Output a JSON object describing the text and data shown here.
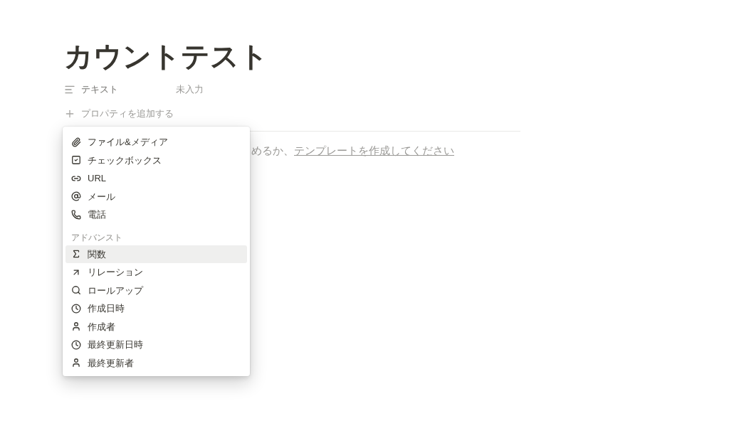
{
  "page": {
    "title": "カウントテスト",
    "properties": [
      {
        "kind": "text",
        "name": "テキスト",
        "value": "未入力"
      }
    ],
    "add_property": "プロパティを追加する",
    "hint": {
      "text": "めるか、",
      "link": "テンプレートを作成してください"
    }
  },
  "menu": {
    "sections": [
      {
        "items": [
          {
            "kind": "file",
            "label": "ファイル&メディア",
            "selected": false
          },
          {
            "kind": "checkbox",
            "label": "チェックボックス",
            "selected": false
          },
          {
            "kind": "url",
            "label": "URL",
            "selected": false
          },
          {
            "kind": "email",
            "label": "メール",
            "selected": false
          },
          {
            "kind": "phone",
            "label": "電話",
            "selected": false
          }
        ]
      },
      {
        "header": "アドバンスト",
        "items": [
          {
            "kind": "formula",
            "label": "関数",
            "selected": true
          },
          {
            "kind": "relation",
            "label": "リレーション",
            "selected": false
          },
          {
            "kind": "rollup",
            "label": "ロールアップ",
            "selected": false
          },
          {
            "kind": "created_time",
            "label": "作成日時",
            "selected": false
          },
          {
            "kind": "created_by",
            "label": "作成者",
            "selected": false
          },
          {
            "kind": "edited_time",
            "label": "最終更新日時",
            "selected": false
          },
          {
            "kind": "edited_by",
            "label": "最終更新者",
            "selected": false
          }
        ]
      }
    ]
  }
}
